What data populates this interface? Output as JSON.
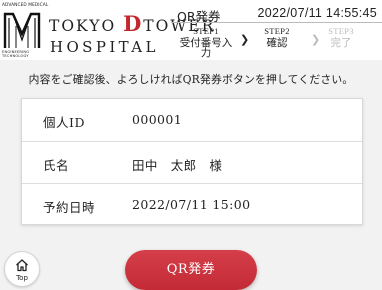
{
  "logo": {
    "top_text": "ADVANCED MEDICAL",
    "bottom_text": "ENGINEERING TECHNOLOGY",
    "name_line1_prefix": "TOKYO ",
    "name_line1_letter": "D",
    "name_line1_suffix": "TOWER",
    "name_line2": "HOSPITAL",
    "accent_color": "#c1272d"
  },
  "header": {
    "page_label": "QR発券",
    "datetime": "2022/07/11 14:55:45"
  },
  "steps": [
    {
      "num": "STEP1",
      "label": "受付番号入力",
      "state": "done"
    },
    {
      "num": "STEP2",
      "label": "確認",
      "state": "current"
    },
    {
      "num": "STEP3",
      "label": "完了",
      "state": "future"
    }
  ],
  "instruction": "内容をご確認後、よろしければQR発券ボタンを押してください。",
  "info": [
    {
      "label": "個人ID",
      "value": "000001"
    },
    {
      "label": "氏名",
      "value": "田中　太郎　様"
    },
    {
      "label": "予約日時",
      "value": "2022/07/11 15:00"
    }
  ],
  "buttons": {
    "top_label": "Top",
    "issue_label": "QR発券",
    "issue_color": "#c8303a"
  }
}
